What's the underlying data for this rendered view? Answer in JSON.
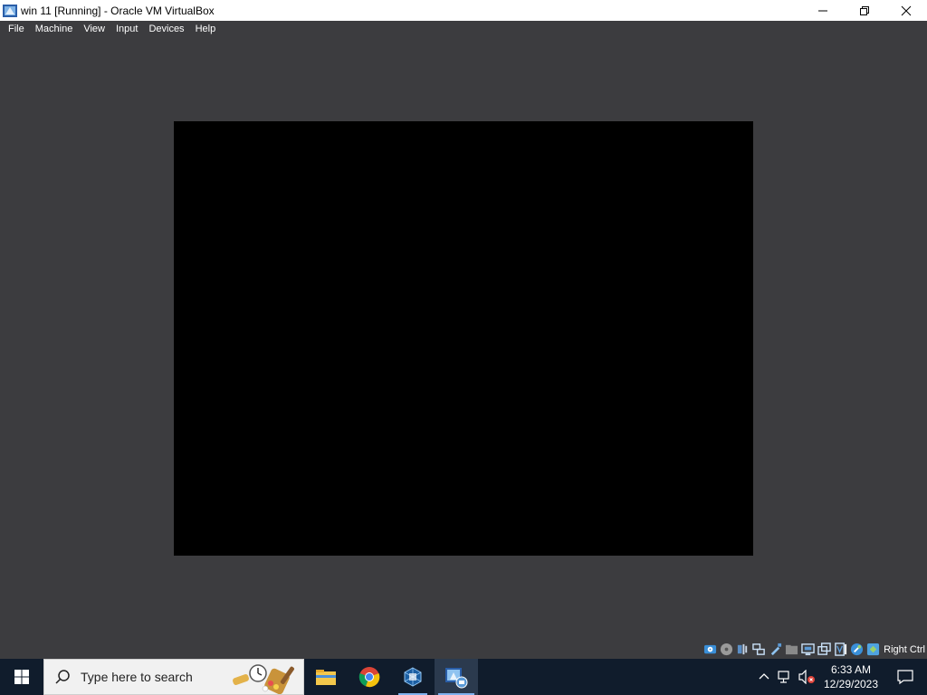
{
  "window": {
    "title": "win 11 [Running] - Oracle VM VirtualBox",
    "controls": [
      "minimize",
      "restore",
      "close"
    ]
  },
  "menubar": {
    "items": [
      "File",
      "Machine",
      "View",
      "Input",
      "Devices",
      "Help"
    ]
  },
  "vm_display": {
    "background": "#000000"
  },
  "statusbar": {
    "icons": [
      "hard-disk-icon",
      "optical-drive-icon",
      "audio-icon",
      "network-icon",
      "usb-icon",
      "shared-folders-icon",
      "display-icon",
      "recording-icon",
      "cpu-icon",
      "mouse-integration-icon",
      "keyboard-icon"
    ],
    "host_key": "Right Ctrl"
  },
  "taskbar": {
    "search_placeholder": "Type here to search",
    "apps": [
      {
        "name": "file-explorer-icon",
        "active": false
      },
      {
        "name": "chrome-icon",
        "active": false
      },
      {
        "name": "virtualbox-icon",
        "active": false
      },
      {
        "name": "virtualbox-vm-icon",
        "active": true
      }
    ],
    "tray_icons": [
      "chevron-up-icon",
      "network-icon",
      "volume-muted-icon"
    ],
    "clock": {
      "time": "6:33 AM",
      "date": "12/29/2023"
    }
  },
  "colors": {
    "window_bg": "#3c3c3f",
    "taskbar_bg": "#101c2c",
    "accent": "#7fb2ef"
  }
}
